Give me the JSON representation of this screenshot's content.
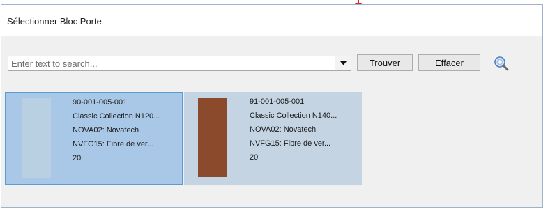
{
  "dialog": {
    "title": "Sélectionner Bloc Porte"
  },
  "search": {
    "placeholder": "Enter text to search...",
    "value": "",
    "find_label": "Trouver",
    "clear_label": "Effacer"
  },
  "results": {
    "items": [
      {
        "code": "90-001-005-001",
        "collection": "Classic Collection N120...",
        "supplier": "NOVA02: Novatech",
        "material": "NVFG15: Fibre de ver...",
        "quantity": "20",
        "swatch_color": "#b9cfe2",
        "selected": true
      },
      {
        "code": "91-001-005-001",
        "collection": "Classic Collection N140...",
        "supplier": "NOVA02: Novatech",
        "material": "NVFG15: Fibre de ver...",
        "quantity": "20",
        "swatch_color": "#8b4a2b",
        "selected": false
      }
    ]
  },
  "colors": {
    "selection_fill": "#a9c8e7",
    "selection_border": "#5b9bd5",
    "card_fill": "#c5d4e3",
    "pointer_arrow": "#e02020"
  },
  "icons": {
    "dropdown": "chevron-down-icon",
    "zoom": "zoom-in-icon",
    "pointer": "red-arrow-icon"
  }
}
